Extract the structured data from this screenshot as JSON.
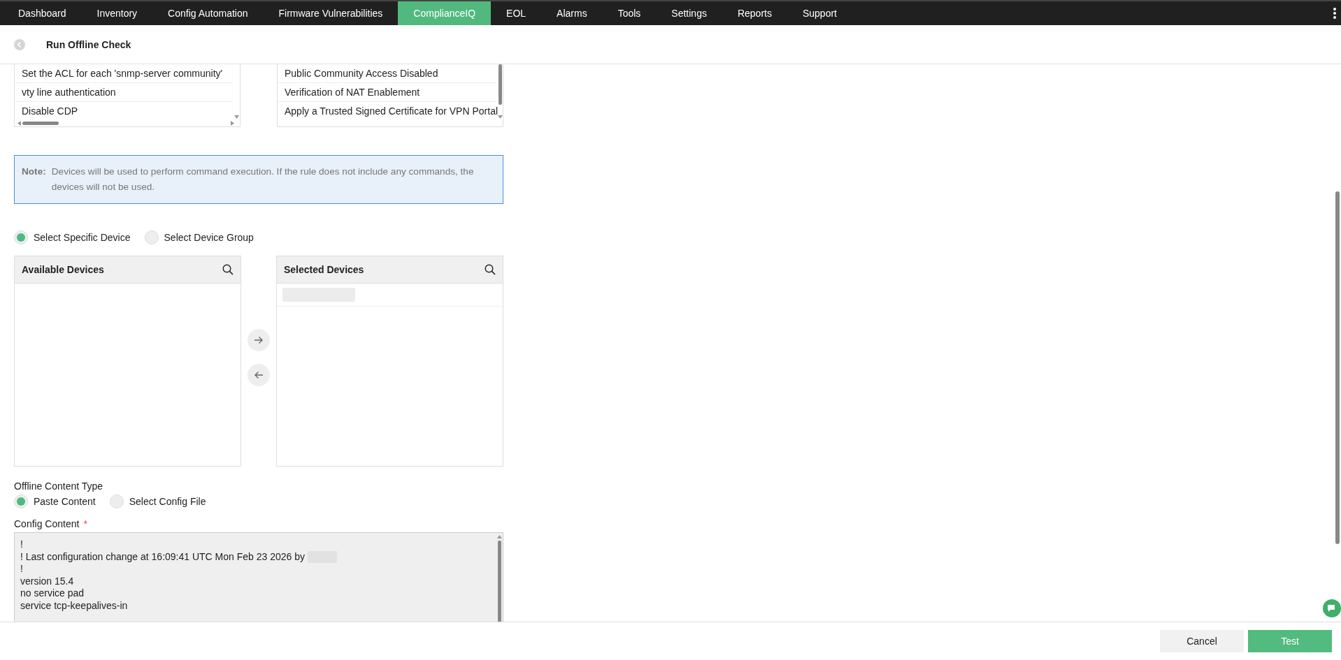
{
  "nav": {
    "tabs": [
      {
        "label": "Dashboard",
        "selected": false
      },
      {
        "label": "Inventory",
        "selected": false
      },
      {
        "label": "Config Automation",
        "selected": false
      },
      {
        "label": "Firmware Vulnerabilities",
        "selected": false
      },
      {
        "label": "ComplianceIQ",
        "selected": true
      },
      {
        "label": "EOL",
        "selected": false
      },
      {
        "label": "Alarms",
        "selected": false
      },
      {
        "label": "Tools",
        "selected": false
      },
      {
        "label": "Settings",
        "selected": false
      },
      {
        "label": "Reports",
        "selected": false
      },
      {
        "label": "Support",
        "selected": false
      }
    ]
  },
  "header": {
    "title": "Run Offline Check"
  },
  "rule_lists": [
    {
      "items": [
        "Set the ACL for each 'snmp-server community'",
        "vty line authentication",
        "Disable CDP"
      ]
    },
    {
      "items": [
        "Public Community Access Disabled",
        "Verification of NAT Enablement",
        "Apply a Trusted Signed Certificate for VPN Portal"
      ]
    }
  ],
  "note": {
    "label": "Note:",
    "text": "Devices will be used to perform command execution. If the rule does not include any commands, the devices will not be used."
  },
  "device_mode": [
    {
      "label": "Select Specific Device",
      "selected": true
    },
    {
      "label": "Select Device Group",
      "selected": false
    }
  ],
  "device_panels": [
    {
      "title": "Available Devices"
    },
    {
      "title": "Selected Devices",
      "rows": [
        {
          "kind": "redacted"
        }
      ]
    }
  ],
  "offline_content_type": {
    "label": "Offline Content Type",
    "options": [
      {
        "label": "Paste Content",
        "selected": true
      },
      {
        "label": "Select Config File",
        "selected": false
      }
    ]
  },
  "config_content": {
    "label": "Config Content",
    "required_mark": "*",
    "lines": [
      {
        "text": "!",
        "redacted_suffix": false
      },
      {
        "text": "! Last configuration change at 16:09:41 UTC Mon Feb 23 2026 by",
        "redacted_suffix": true
      },
      {
        "text": "!",
        "redacted_suffix": false
      },
      {
        "text": "version 15.4",
        "redacted_suffix": false
      },
      {
        "text": "no service pad",
        "redacted_suffix": false
      },
      {
        "text": "service tcp-keepalives-in",
        "redacted_suffix": false
      }
    ]
  },
  "footer": {
    "buttons": [
      {
        "label": "Cancel",
        "kind": "secondary"
      },
      {
        "label": "Test",
        "kind": "primary"
      }
    ]
  }
}
